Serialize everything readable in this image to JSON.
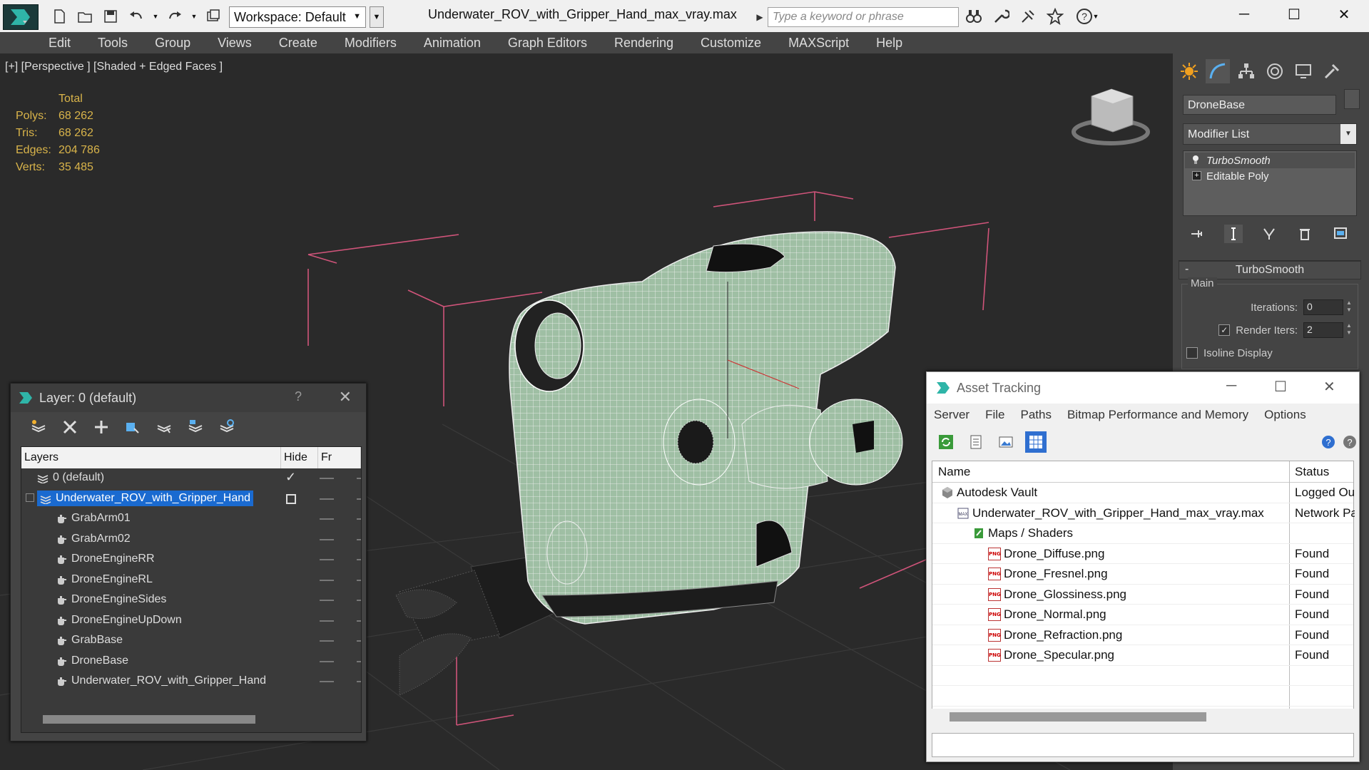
{
  "titlebar": {
    "workspace": "Workspace: Default",
    "document_title": "Underwater_ROV_with_Gripper_Hand_max_vray.max",
    "search_placeholder": "Type a keyword or phrase"
  },
  "menubar": [
    "Edit",
    "Tools",
    "Group",
    "Views",
    "Create",
    "Modifiers",
    "Animation",
    "Graph Editors",
    "Rendering",
    "Customize",
    "MAXScript",
    "Help"
  ],
  "viewport": {
    "label": "[+] [Perspective ] [Shaded + Edged Faces ]",
    "stats": {
      "header": "Total",
      "rows": [
        {
          "key": "Polys:",
          "value": "68 262"
        },
        {
          "key": "Tris:",
          "value": "68 262"
        },
        {
          "key": "Edges:",
          "value": "204 786"
        },
        {
          "key": "Verts:",
          "value": "35 485"
        }
      ]
    }
  },
  "command_panel": {
    "object_name": "DroneBase",
    "modifier_list": "Modifier List",
    "stack": [
      "TurboSmooth",
      "Editable Poly"
    ],
    "rollout_title": "TurboSmooth",
    "group_label": "Main",
    "iterations_label": "Iterations:",
    "iterations_value": "0",
    "render_iters_label": "Render Iters:",
    "render_iters_value": "2",
    "isoline_label": "Isoline Display"
  },
  "layer_window": {
    "title": "Layer: 0 (default)",
    "help": "?",
    "columns": [
      "Layers",
      "Hide",
      "Fr"
    ],
    "rows": [
      {
        "name": "0 (default)",
        "type": "layer",
        "indent": 1
      },
      {
        "name": "Underwater_ROV_with_Gripper_Hand",
        "type": "layer",
        "indent": 0,
        "selected": true
      },
      {
        "name": "GrabArm01",
        "type": "object",
        "indent": 2
      },
      {
        "name": "GrabArm02",
        "type": "object",
        "indent": 2
      },
      {
        "name": "DroneEngineRR",
        "type": "object",
        "indent": 2
      },
      {
        "name": "DroneEngineRL",
        "type": "object",
        "indent": 2
      },
      {
        "name": "DroneEngineSides",
        "type": "object",
        "indent": 2
      },
      {
        "name": "DroneEngineUpDown",
        "type": "object",
        "indent": 2
      },
      {
        "name": "GrabBase",
        "type": "object",
        "indent": 2
      },
      {
        "name": "DroneBase",
        "type": "object",
        "indent": 2
      },
      {
        "name": "Underwater_ROV_with_Gripper_Hand",
        "type": "object",
        "indent": 2
      }
    ]
  },
  "asset_window": {
    "title": "Asset Tracking",
    "menu": [
      "Server",
      "File",
      "Paths",
      "Bitmap Performance and Memory",
      "Options"
    ],
    "columns": [
      "Name",
      "Status"
    ],
    "rows": [
      {
        "name": "Autodesk Vault",
        "status": "Logged Ou",
        "icon": "vault",
        "level": 1
      },
      {
        "name": "Underwater_ROV_with_Gripper_Hand_max_vray.max",
        "status": "Network Pa",
        "icon": "max",
        "level": 2
      },
      {
        "name": "Maps / Shaders",
        "status": "",
        "icon": "maps",
        "level": 3
      },
      {
        "name": "Drone_Diffuse.png",
        "status": "Found",
        "icon": "png",
        "level": 4
      },
      {
        "name": "Drone_Fresnel.png",
        "status": "Found",
        "icon": "png",
        "level": 4
      },
      {
        "name": "Drone_Glossiness.png",
        "status": "Found",
        "icon": "png",
        "level": 4
      },
      {
        "name": "Drone_Normal.png",
        "status": "Found",
        "icon": "png",
        "level": 4
      },
      {
        "name": "Drone_Refraction.png",
        "status": "Found",
        "icon": "png",
        "level": 4
      },
      {
        "name": "Drone_Specular.png",
        "status": "Found",
        "icon": "png",
        "level": 4
      }
    ]
  },
  "colors": {
    "stats_text": "#d9b44a",
    "selection_blue": "#1a6ad0",
    "bbox_pink": "#d0547a",
    "mesh_fill": "#9fbfa4"
  }
}
